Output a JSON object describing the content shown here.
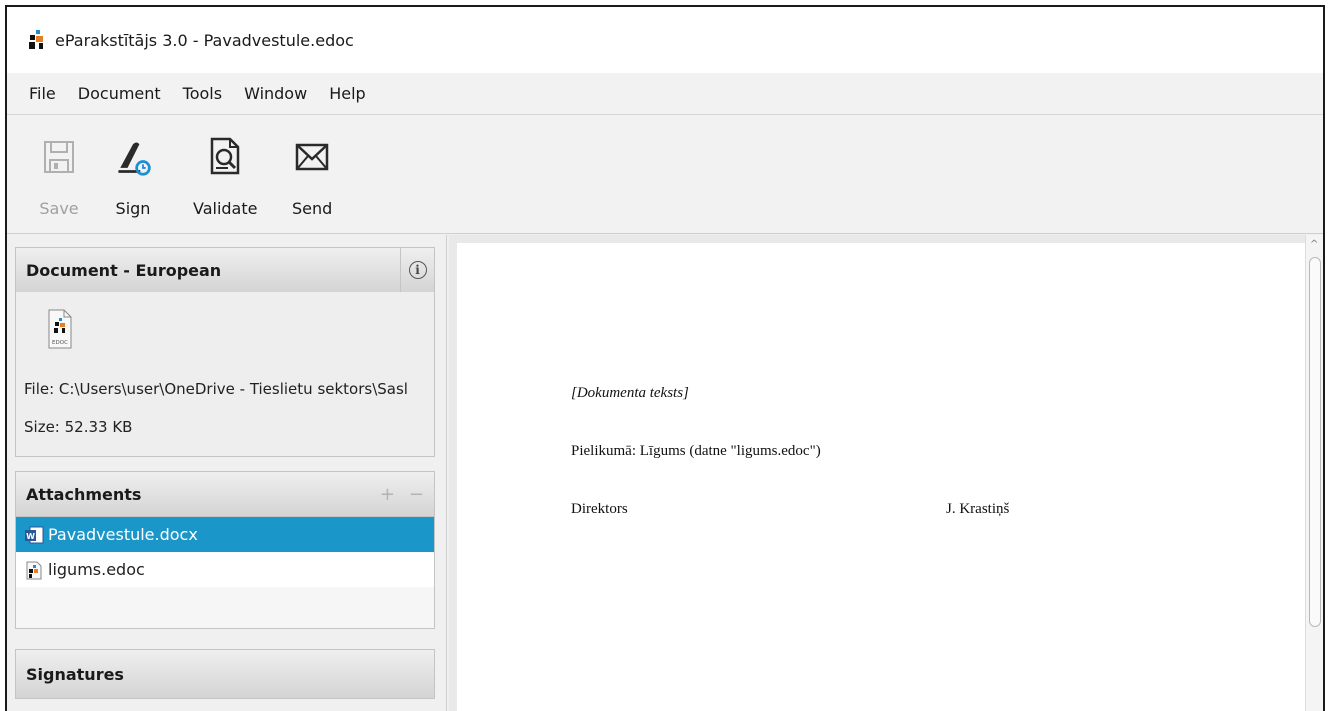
{
  "window": {
    "title": "eParakstītājs 3.0 - Pavadvestule.edoc"
  },
  "menu": [
    "File",
    "Document",
    "Tools",
    "Window",
    "Help"
  ],
  "toolbar": {
    "save": {
      "label": "Save",
      "icon": "save-icon",
      "enabled": false
    },
    "sign": {
      "label": "Sign",
      "icon": "sign-pen-icon"
    },
    "validate": {
      "label": "Validate",
      "icon": "validate-icon"
    },
    "send": {
      "label": "Send",
      "icon": "envelope-icon"
    }
  },
  "document_panel": {
    "header": "Document - European",
    "file_line": "File: C:\\Users\\user\\OneDrive - Tieslietu sektors\\Sasl",
    "size_line": "Size: 52.33 KB",
    "file_icon_label": "EDOC"
  },
  "attachments": {
    "header": "Attachments",
    "add_symbol": "+",
    "remove_symbol": "−",
    "items": [
      {
        "name": "Pavadvestule.docx",
        "icon": "word-icon",
        "selected": true
      },
      {
        "name": "ligums.edoc",
        "icon": "edoc-icon",
        "selected": false
      }
    ]
  },
  "signatures": {
    "header": "Signatures"
  },
  "document_content": {
    "placeholder": "[Dokumenta teksts]",
    "attachment_note": "Pielikumā: Līgums (datne \"ligums.edoc\")",
    "role": "Direktors",
    "signer": "J. Krastiņš"
  },
  "colors": {
    "selection": "#1a96c9",
    "accent_blue": "#1a8fd6"
  }
}
